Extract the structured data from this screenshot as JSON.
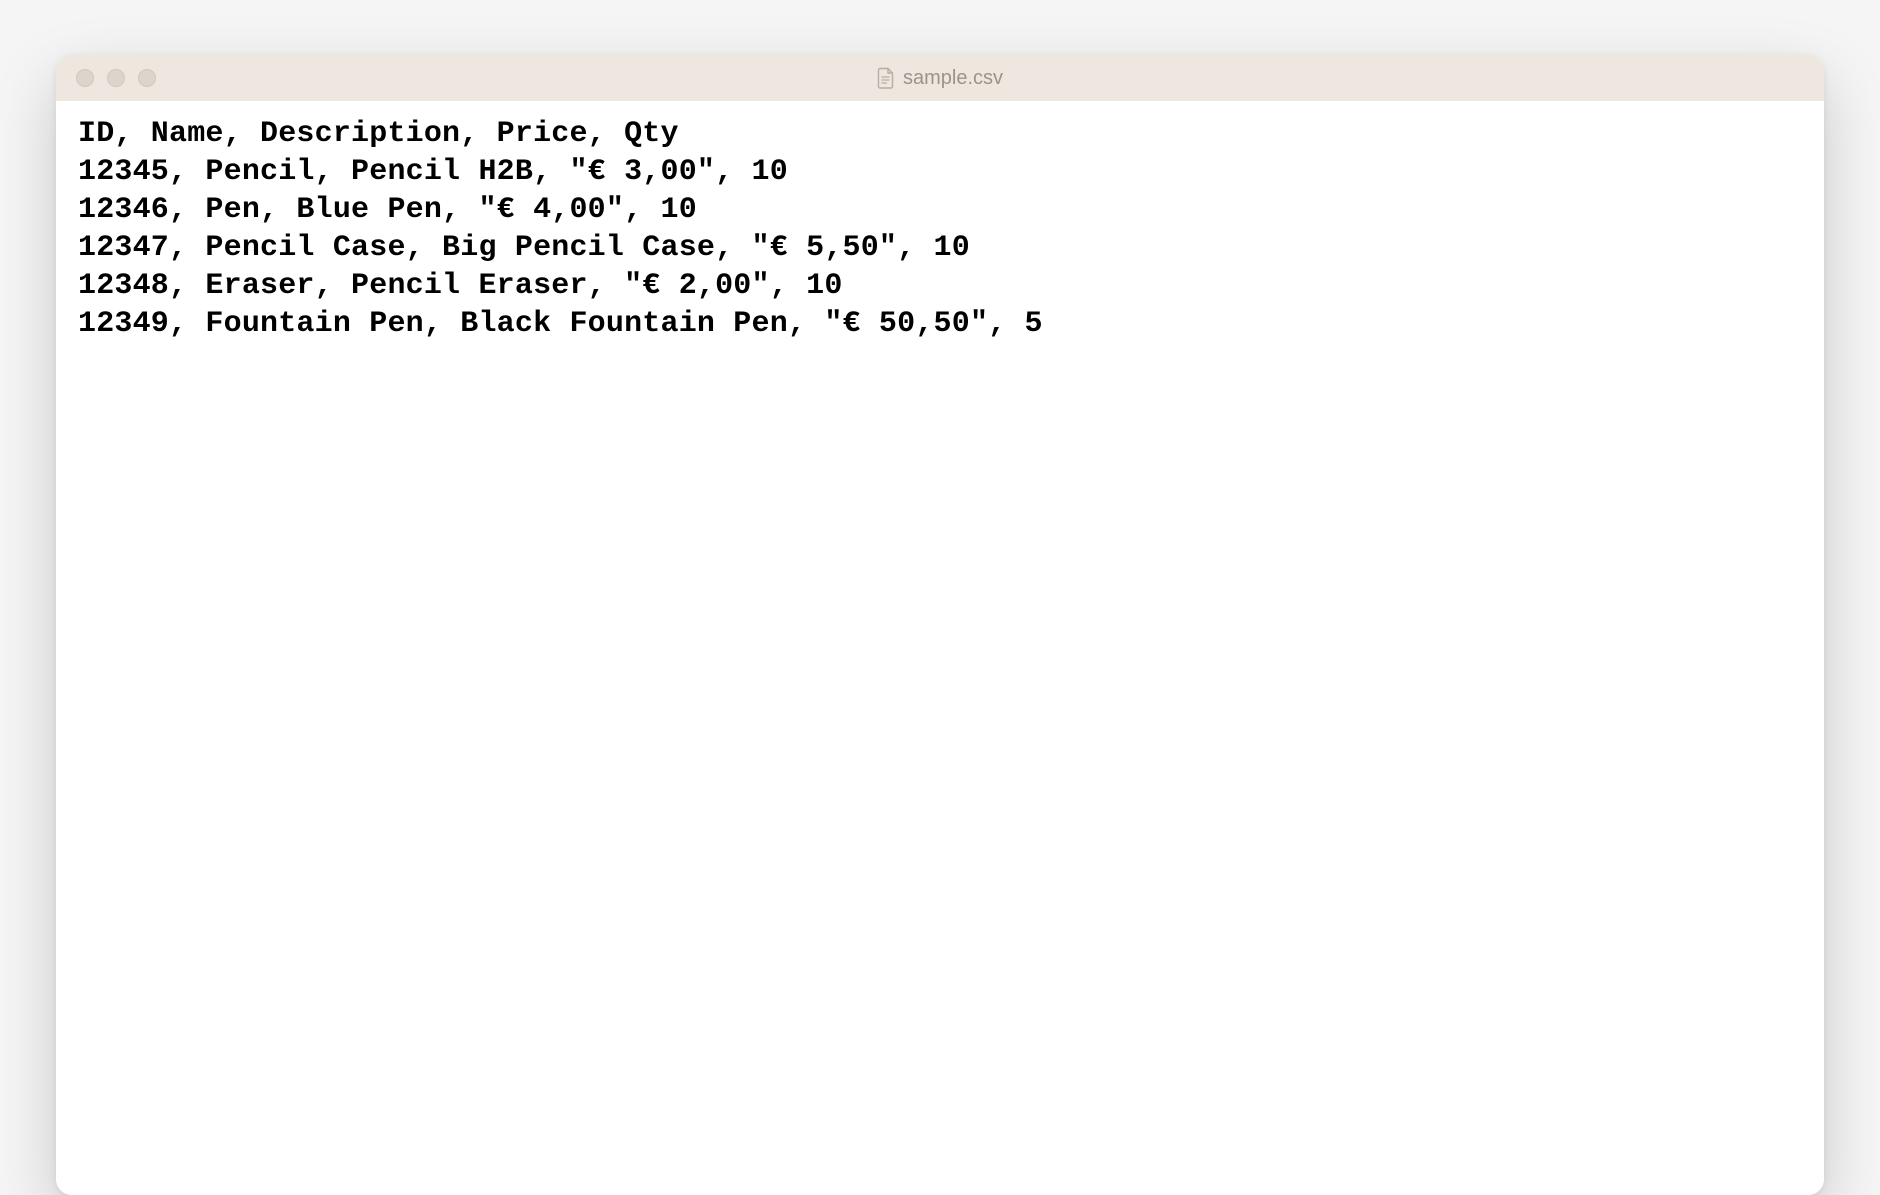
{
  "window": {
    "title": "sample.csv"
  },
  "file": {
    "lines": [
      "ID, Name, Description, Price, Qty",
      "12345, Pencil, Pencil H2B, \"€ 3,00\", 10",
      "12346, Pen, Blue Pen, \"€ 4,00\", 10",
      "12347, Pencil Case, Big Pencil Case, \"€ 5,50\", 10",
      "12348, Eraser, Pencil Eraser, \"€ 2,00\", 10",
      "12349, Fountain Pen, Black Fountain Pen, \"€ 50,50\", 5"
    ]
  }
}
